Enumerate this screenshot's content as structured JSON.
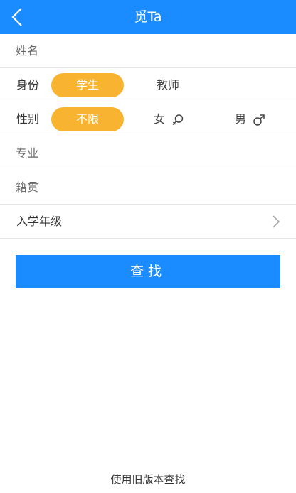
{
  "header": {
    "title": "觅Ta",
    "back_icon": "chevron-left-icon"
  },
  "form": {
    "name": {
      "placeholder": "姓名",
      "value": ""
    },
    "identity": {
      "label": "身份",
      "options": [
        "学生",
        "教师"
      ],
      "selected": "学生"
    },
    "gender": {
      "label": "性别",
      "options": [
        {
          "label": "不限",
          "icon": ""
        },
        {
          "label": "女",
          "icon": "female-icon"
        },
        {
          "label": "男",
          "icon": "male-icon"
        }
      ],
      "selected": "不限"
    },
    "major": {
      "placeholder": "专业",
      "value": ""
    },
    "hometown": {
      "placeholder": "籍贯",
      "value": ""
    },
    "enrollment_year": {
      "label": "入学年级",
      "icon": "chevron-right-icon"
    }
  },
  "search_button": {
    "label": "查找"
  },
  "footer": {
    "old_version_link": "使用旧版本查找"
  },
  "colors": {
    "header": "#1a8cff",
    "pill": "#f8b331",
    "button": "#1a8cff",
    "divider": "#e6e6e6"
  }
}
